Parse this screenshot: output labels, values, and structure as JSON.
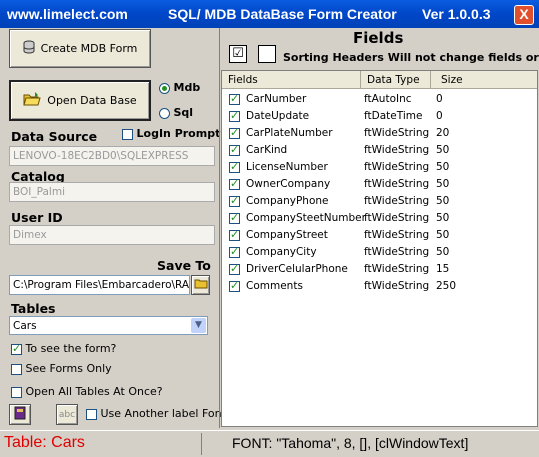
{
  "titlebar": {
    "site": "www.limelect.com",
    "app": "SQL/ MDB DataBase Form Creator",
    "version": "Ver 1.0.0.3",
    "close": "X"
  },
  "left": {
    "create_btn": "Create MDB Form",
    "open_btn": "Open Data Base",
    "radio_mdb": "Mdb",
    "radio_sql": "Sql",
    "data_source_label": "Data Source",
    "login_prompt": "LogIn Prompt",
    "data_source_value": "LENOVO-18EC2BD0\\SQLEXPRESS",
    "catalog_label": "Catalog",
    "catalog_value": "BOI_Palmi",
    "userid_label": "User ID",
    "userid_value": "Dimex",
    "saveto_label": "Save To",
    "saveto_value": "C:\\Program Files\\Embarcadero\\RAD",
    "tables_label": "Tables",
    "tables_selected": "Cars",
    "to_see_form": "To see the form?",
    "see_forms_only": "See Forms Only",
    "open_all_tables": "Open All Tables At Once?",
    "abc_label": "abc",
    "use_another_font": "Use Another label Font"
  },
  "right": {
    "title": "Fields",
    "sorting_note": "Sorting Headers Will not change fields order",
    "headers": [
      "Fields",
      "Data Type",
      "Size"
    ],
    "rows": [
      {
        "name": "CarNumber",
        "type": "ftAutoInc",
        "size": "0"
      },
      {
        "name": "DateUpdate",
        "type": "ftDateTime",
        "size": "0"
      },
      {
        "name": "CarPlateNumber",
        "type": "ftWideString",
        "size": "20"
      },
      {
        "name": "CarKind",
        "type": "ftWideString",
        "size": "50"
      },
      {
        "name": "LicenseNumber",
        "type": "ftWideString",
        "size": "50"
      },
      {
        "name": "OwnerCompany",
        "type": "ftWideString",
        "size": "50"
      },
      {
        "name": "CompanyPhone",
        "type": "ftWideString",
        "size": "50"
      },
      {
        "name": "CompanySteetNumber",
        "type": "ftWideString",
        "size": "50"
      },
      {
        "name": "CompanyStreet",
        "type": "ftWideString",
        "size": "50"
      },
      {
        "name": "CompanyCity",
        "type": "ftWideString",
        "size": "50"
      },
      {
        "name": "DriverCelularPhone",
        "type": "ftWideString",
        "size": "15"
      },
      {
        "name": "Comments",
        "type": "ftWideString",
        "size": "250"
      }
    ]
  },
  "status": {
    "table": "Table: Cars",
    "font": "FONT:  \"Tahoma\", 8, [], [clWindowText]"
  },
  "colors": {
    "titlebar": "#0046c8",
    "status_table": "#e00000",
    "check": "#219121"
  }
}
